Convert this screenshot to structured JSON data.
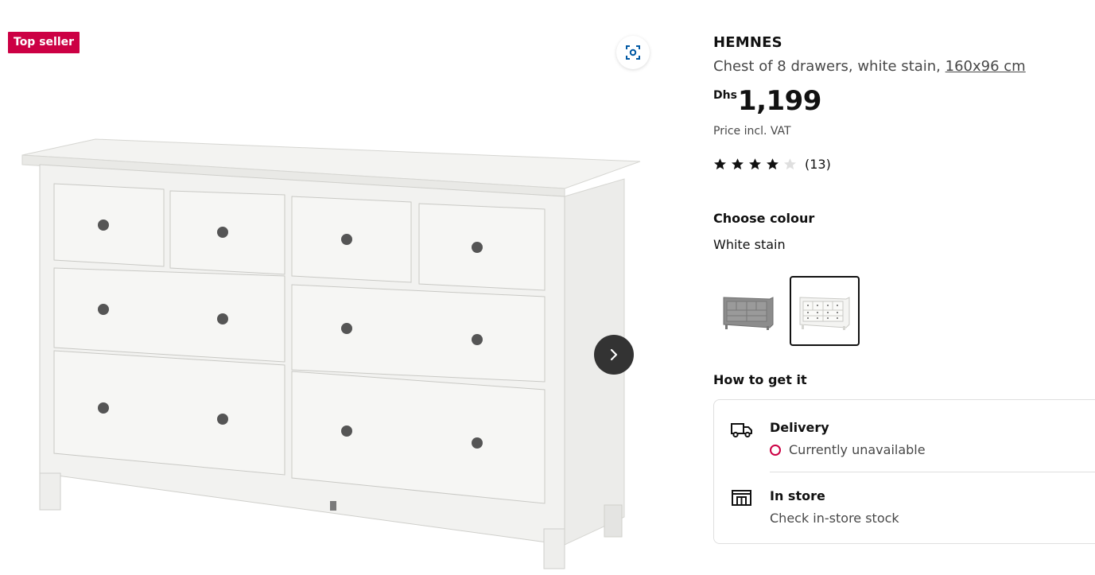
{
  "badge": {
    "label": "Top seller",
    "color": "#cc0044"
  },
  "gallery": {
    "scan_icon": "scan-focus-icon",
    "next_icon": "chevron-right-icon"
  },
  "product": {
    "name": "HEMNES",
    "description": "Chest of 8 drawers, white stain, ",
    "size_link": "160x96 cm",
    "price": {
      "currency": "Dhs",
      "amount": "1,199"
    },
    "vat_note": "Price incl. VAT",
    "rating": {
      "stars_filled": 4,
      "stars_total": 5,
      "count": "(13)"
    }
  },
  "colour": {
    "title": "Choose colour",
    "selected": "White stain",
    "swatches": [
      {
        "name": "grey",
        "selected": false
      },
      {
        "name": "white stain",
        "selected": true
      }
    ]
  },
  "availability": {
    "title": "How to get it",
    "delivery": {
      "title": "Delivery",
      "status": "Currently unavailable",
      "status_color": "#cc0044",
      "icon": "delivery-truck-icon"
    },
    "store": {
      "title": "In store",
      "status": "Check in-store stock",
      "icon": "store-icon"
    }
  }
}
